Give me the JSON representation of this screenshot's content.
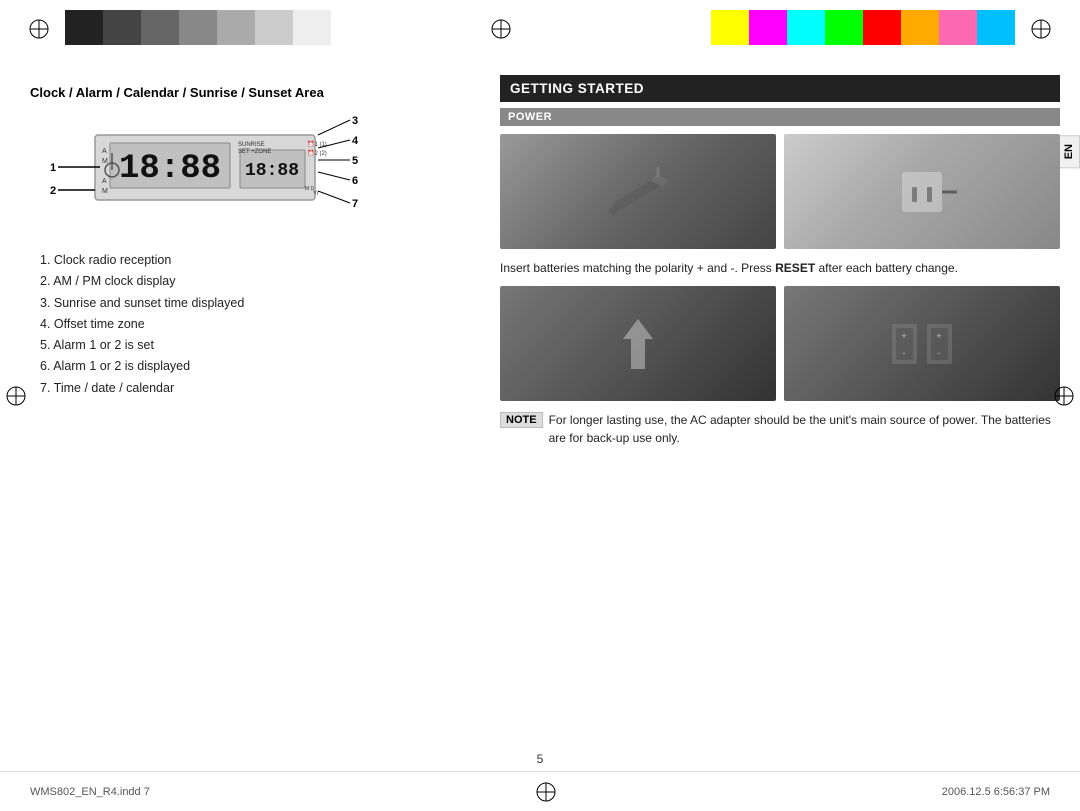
{
  "colorBars": {
    "grayscale": [
      "#222",
      "#444",
      "#666",
      "#888",
      "#aaa",
      "#ccc",
      "#eee"
    ],
    "colors": [
      "#ffff00",
      "#ff00ff",
      "#00ffff",
      "#00ff00",
      "#ff0000",
      "#ffaa00",
      "#ff69b4",
      "#00bfff"
    ]
  },
  "leftPanel": {
    "sectionTitle": "Clock / Alarm / Calendar / Sunrise / Sunset Area",
    "clockDisplay": "18:88",
    "calloutNumbers": [
      "3",
      "4",
      "5",
      "6",
      "7"
    ],
    "leftLabels": [
      "1",
      "2"
    ],
    "numberedList": [
      "1. Clock radio reception",
      "2. AM / PM clock display",
      "3. Sunrise and sunset time displayed",
      "4. Offset time zone",
      "5. Alarm 1 or 2 is set",
      "6. Alarm 1 or 2 is displayed",
      "7. Time / date / calendar"
    ]
  },
  "rightPanel": {
    "enTab": "EN",
    "gettingStartedHeader": "GETTING STARTED",
    "powerHeader": "POWER",
    "insertText": "Insert batteries matching the polarity + and  -. Press ",
    "insertTextBold": "RESET",
    "insertTextAfter": " after each battery change.",
    "noteLabel": "NOTE",
    "noteText": "For longer lasting use, the AC adapter should be the unit's main source of power. The batteries are for back-up use only."
  },
  "footer": {
    "left": "WMS802_EN_R4.indd   7",
    "pageNumber": "5",
    "right": "2006.12.5   6:56:37 PM"
  }
}
